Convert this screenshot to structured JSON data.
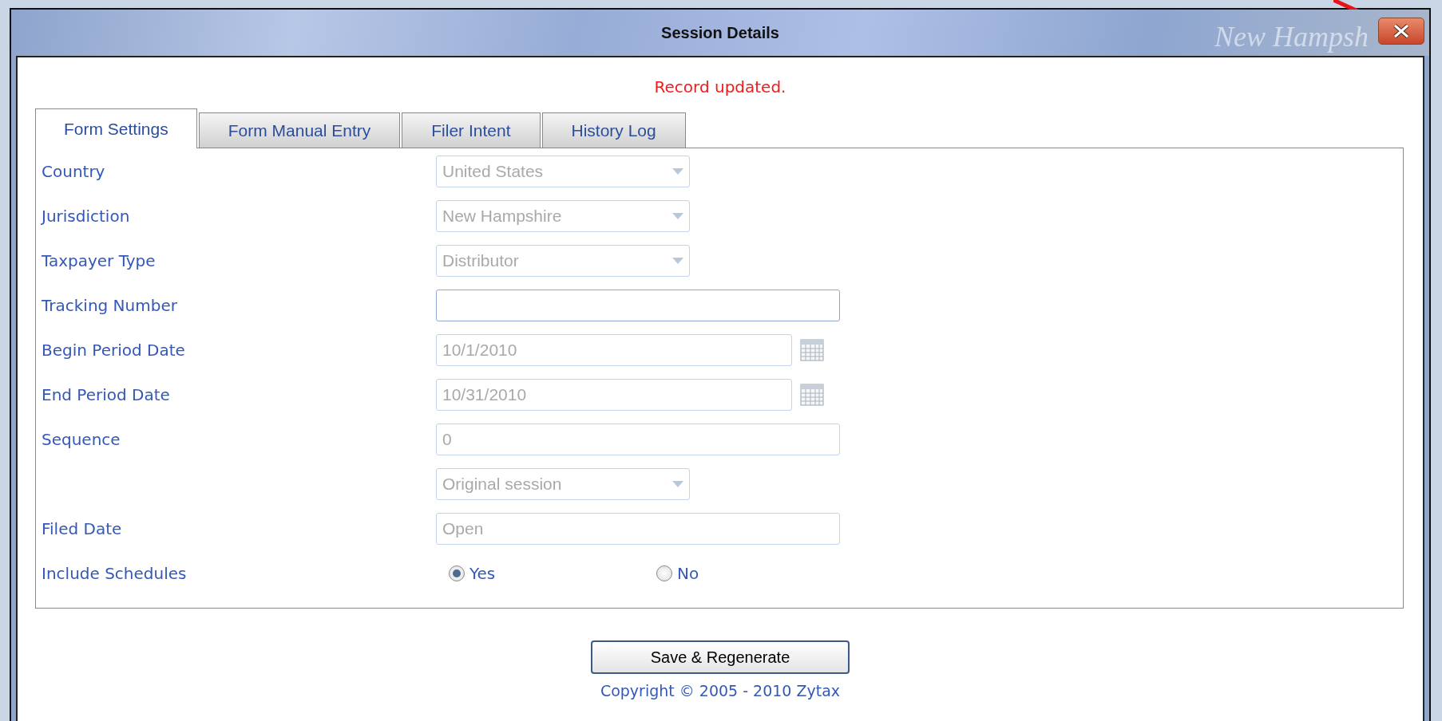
{
  "window": {
    "title": "Session Details",
    "background_text": "New Hampsh"
  },
  "message": "Record updated.",
  "tabs": [
    {
      "label": "Form Settings",
      "selected": true
    },
    {
      "label": "Form Manual Entry",
      "selected": false
    },
    {
      "label": "Filer Intent",
      "selected": false
    },
    {
      "label": "History Log",
      "selected": false
    }
  ],
  "fields": [
    {
      "kind": "select",
      "label": "Country",
      "value": "United States",
      "disabled": true
    },
    {
      "kind": "select",
      "label": "Jurisdiction",
      "value": "New Hampshire",
      "disabled": true
    },
    {
      "kind": "select",
      "label": "Taxpayer Type",
      "value": "Distributor",
      "disabled": true
    },
    {
      "kind": "text",
      "label": "Tracking Number",
      "disabled": false
    },
    {
      "kind": "date",
      "label": "Begin Period Date",
      "value": "10/1/2010",
      "disabled": true
    },
    {
      "kind": "date",
      "label": "End Period Date",
      "value": "10/31/2010",
      "disabled": true
    },
    {
      "kind": "text",
      "label": "Sequence",
      "value": "0",
      "disabled": true
    },
    {
      "kind": "select",
      "value": "Original session",
      "disabled": true
    },
    {
      "kind": "text",
      "label": "Filed Date",
      "value": "Open",
      "disabled": true
    },
    {
      "kind": "radio",
      "label": "Include Schedules",
      "options": [
        {
          "label": "Yes",
          "selected": true
        },
        {
          "label": "No",
          "selected": false
        }
      ]
    }
  ],
  "buttons": [
    "Save & Regenerate"
  ],
  "footer": "Copyright © 2005 - 2010 Zytax"
}
